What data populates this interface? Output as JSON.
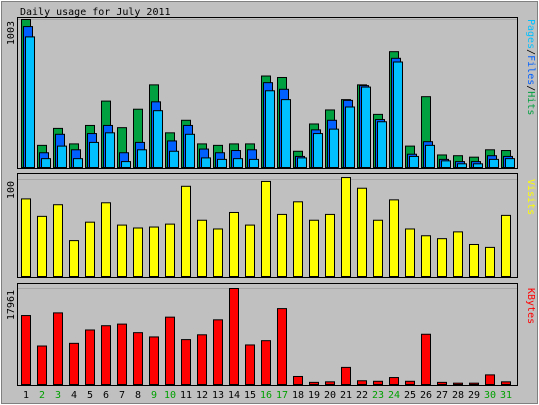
{
  "title": "Daily usage for July 2011",
  "colors": {
    "background": "#c0c0c0",
    "hits": "#00a040",
    "files": "#0060ff",
    "pages": "#00c0ff",
    "visits": "#ffff00",
    "kbytes": "#ff0000",
    "weekend_label": "#00a000",
    "weekday_label": "#000000"
  },
  "chart_data": [
    {
      "type": "bar",
      "panel": "top",
      "ylabel_parts": [
        {
          "text": "Pages",
          "color": "#00c0ff"
        },
        {
          "text": "/",
          "color": "#000000"
        },
        {
          "text": "Files",
          "color": "#0060ff"
        },
        {
          "text": "/",
          "color": "#000000"
        },
        {
          "text": "Hits",
          "color": "#00a040"
        }
      ],
      "ymax_label": "1003",
      "ylim": [
        0,
        1003
      ],
      "categories": [
        "1",
        "2",
        "3",
        "4",
        "5",
        "6",
        "7",
        "8",
        "9",
        "10",
        "11",
        "12",
        "13",
        "14",
        "15",
        "16",
        "17",
        "18",
        "19",
        "20",
        "21",
        "22",
        "23",
        "24",
        "25",
        "26",
        "27",
        "28",
        "29",
        "30",
        "31"
      ],
      "series": [
        {
          "name": "Hits",
          "color": "#00a040",
          "values": [
            1003,
            150,
            265,
            160,
            285,
            450,
            270,
            395,
            560,
            235,
            320,
            160,
            150,
            160,
            160,
            620,
            610,
            110,
            295,
            390,
            460,
            560,
            360,
            785,
            145,
            480,
            85,
            80,
            70,
            120,
            115
          ]
        },
        {
          "name": "Files",
          "color": "#0060ff",
          "values": [
            955,
            100,
            225,
            120,
            230,
            285,
            100,
            170,
            445,
            180,
            285,
            125,
            100,
            115,
            120,
            575,
            530,
            75,
            255,
            320,
            455,
            555,
            325,
            740,
            90,
            175,
            55,
            40,
            40,
            80,
            75
          ]
        },
        {
          "name": "Pages",
          "color": "#00c0ff",
          "values": [
            885,
            60,
            145,
            60,
            170,
            235,
            40,
            120,
            385,
            110,
            225,
            65,
            55,
            60,
            55,
            520,
            460,
            65,
            230,
            260,
            410,
            545,
            310,
            715,
            75,
            150,
            45,
            25,
            25,
            55,
            60
          ]
        }
      ]
    },
    {
      "type": "bar",
      "panel": "middle",
      "ylabel_parts": [
        {
          "text": "Visits",
          "color": "#ffff00"
        }
      ],
      "ymax_label": "100",
      "ylim": [
        0,
        100
      ],
      "categories": [
        "1",
        "2",
        "3",
        "4",
        "5",
        "6",
        "7",
        "8",
        "9",
        "10",
        "11",
        "12",
        "13",
        "14",
        "15",
        "16",
        "17",
        "18",
        "19",
        "20",
        "21",
        "22",
        "23",
        "24",
        "25",
        "26",
        "27",
        "28",
        "29",
        "30",
        "31"
      ],
      "series": [
        {
          "name": "Visits",
          "color": "#ffff00",
          "values": [
            80,
            62,
            74,
            37,
            56,
            76,
            53,
            50,
            51,
            54,
            93,
            58,
            49,
            66,
            53,
            98,
            64,
            77,
            58,
            64,
            102,
            91,
            58,
            79,
            49,
            42,
            39,
            46,
            33,
            30,
            63
          ]
        }
      ]
    },
    {
      "type": "bar",
      "panel": "bottom",
      "ylabel_parts": [
        {
          "text": "KBytes",
          "color": "#ff0000"
        }
      ],
      "ymax_label": "17961",
      "ylim": [
        0,
        17961
      ],
      "categories": [
        "1",
        "2",
        "3",
        "4",
        "5",
        "6",
        "7",
        "8",
        "9",
        "10",
        "11",
        "12",
        "13",
        "14",
        "15",
        "16",
        "17",
        "18",
        "19",
        "20",
        "21",
        "22",
        "23",
        "24",
        "25",
        "26",
        "27",
        "28",
        "29",
        "30",
        "31"
      ],
      "series": [
        {
          "name": "KBytes",
          "color": "#ff0000",
          "values": [
            12900,
            7200,
            13400,
            7700,
            10200,
            11000,
            11300,
            9700,
            8900,
            12600,
            8400,
            9300,
            12100,
            17961,
            7400,
            8200,
            14200,
            1500,
            400,
            500,
            3200,
            700,
            600,
            1300,
            600,
            9400,
            400,
            250,
            250,
            1800,
            500
          ]
        }
      ]
    }
  ],
  "x_labels": [
    {
      "day": "1",
      "weekend": false
    },
    {
      "day": "2",
      "weekend": true
    },
    {
      "day": "3",
      "weekend": true
    },
    {
      "day": "4",
      "weekend": false
    },
    {
      "day": "5",
      "weekend": false
    },
    {
      "day": "6",
      "weekend": false
    },
    {
      "day": "7",
      "weekend": false
    },
    {
      "day": "8",
      "weekend": false
    },
    {
      "day": "9",
      "weekend": true
    },
    {
      "day": "10",
      "weekend": true
    },
    {
      "day": "11",
      "weekend": false
    },
    {
      "day": "12",
      "weekend": false
    },
    {
      "day": "13",
      "weekend": false
    },
    {
      "day": "14",
      "weekend": false
    },
    {
      "day": "15",
      "weekend": false
    },
    {
      "day": "16",
      "weekend": true
    },
    {
      "day": "17",
      "weekend": true
    },
    {
      "day": "18",
      "weekend": false
    },
    {
      "day": "19",
      "weekend": false
    },
    {
      "day": "20",
      "weekend": false
    },
    {
      "day": "21",
      "weekend": false
    },
    {
      "day": "22",
      "weekend": false
    },
    {
      "day": "23",
      "weekend": true
    },
    {
      "day": "24",
      "weekend": true
    },
    {
      "day": "25",
      "weekend": false
    },
    {
      "day": "26",
      "weekend": false
    },
    {
      "day": "27",
      "weekend": false
    },
    {
      "day": "28",
      "weekend": false
    },
    {
      "day": "29",
      "weekend": false
    },
    {
      "day": "30",
      "weekend": true
    },
    {
      "day": "31",
      "weekend": true
    }
  ]
}
